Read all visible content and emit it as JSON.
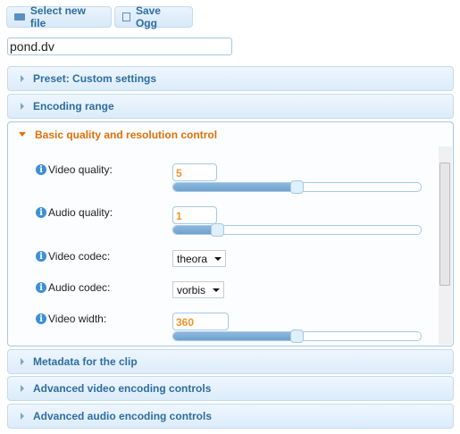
{
  "toolbar": {
    "select_label": "Select new file",
    "save_label": "Save Ogg"
  },
  "file": {
    "value": "pond.dv"
  },
  "sections": [
    "Preset: Custom settings",
    "Encoding range",
    "Basic quality and resolution control",
    "Metadata for the clip",
    "Advanced video encoding controls",
    "Advanced audio encoding controls"
  ],
  "fields": {
    "video_quality": {
      "label": "Video quality:",
      "value": "5",
      "slider_fraction": 0.5
    },
    "audio_quality": {
      "label": "Audio quality:",
      "value": "1",
      "slider_fraction": 0.18
    },
    "video_codec": {
      "label": "Video codec:",
      "value": "theora"
    },
    "audio_codec": {
      "label": "Audio codec:",
      "value": "vorbis"
    },
    "video_width": {
      "label": "Video width:",
      "value": "360",
      "slider_fraction": 0.5
    }
  },
  "colors": {
    "accent": "#e17009",
    "header_text": "#2e6e9e",
    "value": "#f0952c"
  }
}
